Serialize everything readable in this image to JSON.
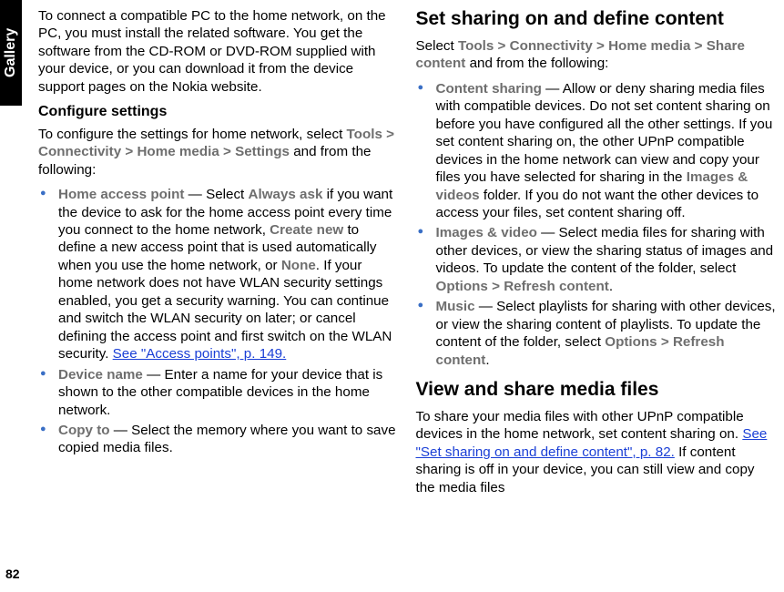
{
  "sideTab": "Gallery",
  "pageNumber": "82",
  "intro": "To connect a compatible PC to the home network, on the PC, you must install the related software. You get the software from the CD-ROM or DVD-ROM supplied with your device, or you can download it from the device support pages on the Nokia website.",
  "configureHeading": "Configure settings",
  "configureIntro_a": "To configure the settings for home network, select ",
  "tools": "Tools",
  "gt": " > ",
  "connectivity": "Connectivity",
  "homeMedia": "Home media",
  "settings": "Settings",
  "andFrom": " and from the following:",
  "bullet1": {
    "label": "Home access point",
    "dash": " — Select ",
    "alwaysAsk": "Always ask",
    "text1": " if you want the device to ask for the home access point every time you connect to the home network, ",
    "createNew": "Create new",
    "text2": " to define a new access point that is used automatically when you use the home network, or ",
    "none": "None",
    "text3": ". If your home network does not have WLAN security settings enabled, you get a security warning. You can continue and switch the WLAN security on later; or cancel defining the access point and first switch on the WLAN security. ",
    "link": "See \"Access points\", p. 149."
  },
  "bullet2": {
    "label": "Device name",
    "text": " — Enter a name for your device that is shown to the other compatible devices in the home network."
  },
  "bullet3": {
    "label": "Copy to",
    "text": " — Select the memory where you want to save copied media files."
  },
  "section2Heading": "Set sharing on and define content",
  "section2Intro_a": "Select ",
  "shareContent": "Share content",
  "bulletS1": {
    "label": "Content sharing",
    "text1": " — Allow or deny sharing media files with compatible devices. Do not set content sharing on before you have configured all the other settings. If you set content sharing on, the other UPnP compatible devices in the home network can view and copy your files you have selected for sharing in the ",
    "imagesVideos": "Images & videos",
    "text2": " folder. If you do not want the other devices to access your files, set content sharing off."
  },
  "bulletS2": {
    "label": "Images & video",
    "text1": " — Select media files for sharing with other devices, or view the sharing status of images and videos. To update the content of the folder, select ",
    "options": "Options",
    "refresh": "Refresh content",
    "period": "."
  },
  "bulletS3": {
    "label": "Music",
    "text1": " — Select playlists for sharing with other devices, or view the sharing content of playlists. To update the content of the folder, select ",
    "options": "Options",
    "refresh": "Refresh content",
    "period": "."
  },
  "section3Heading": "View and share media files",
  "section3Text1": "To share your media files with other UPnP compatible devices in the home network, set content sharing on. ",
  "section3Link": "See \"Set sharing on and define content\", p. 82.",
  "section3Text2": " If content sharing is off in your device, you can still view and copy the media files"
}
